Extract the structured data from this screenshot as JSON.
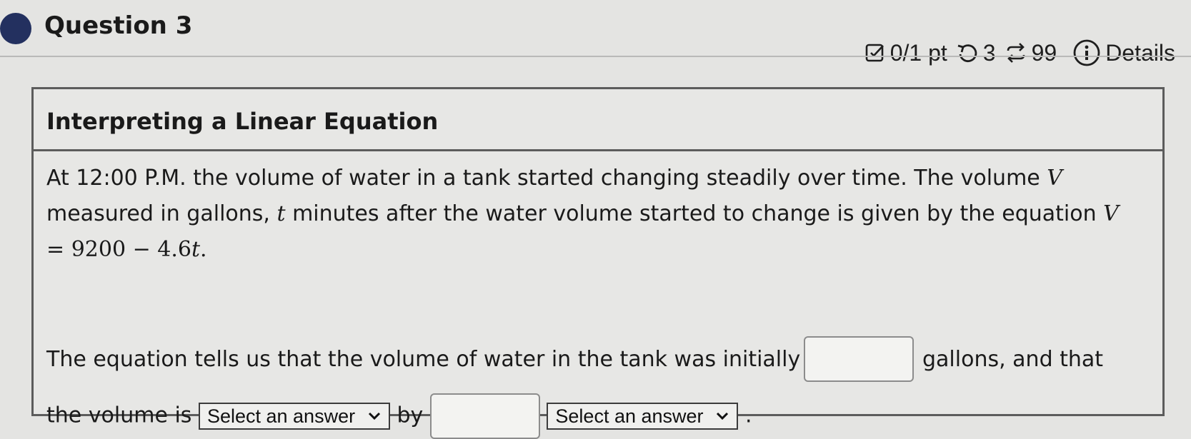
{
  "question": {
    "title": "Question 3"
  },
  "meta": {
    "score": "0/1 pt",
    "retries": "3",
    "attempts": "99",
    "details_label": "Details"
  },
  "panel": {
    "title": "Interpreting a Linear Equation",
    "intro_1": "At 12:00 P.M. the volume of water in a tank started changing steadily over time. The volume ",
    "var_v": "V",
    "intro_2": " measured in gallons, ",
    "var_t": "t",
    "intro_3": " minutes after the water volume started to change is given by the equation ",
    "equation": {
      "lhs": "V",
      "eq": " = ",
      "const": "9200",
      "minus": " − ",
      "coef": "4.6",
      "var": "t",
      "end": "."
    },
    "sentence_1": "The equation tells us that the volume of water in the tank was initially",
    "sentence_2": "gallons, and that",
    "sentence_3": "the volume is",
    "sentence_4": "by",
    "select_1": "Select an answer",
    "select_2": "Select an answer",
    "sentence_end": "."
  },
  "icons": {
    "score": "checkbox-pencil-icon",
    "retry": "retry-icon",
    "attempts": "repeat-icon",
    "details": "info-icon"
  }
}
